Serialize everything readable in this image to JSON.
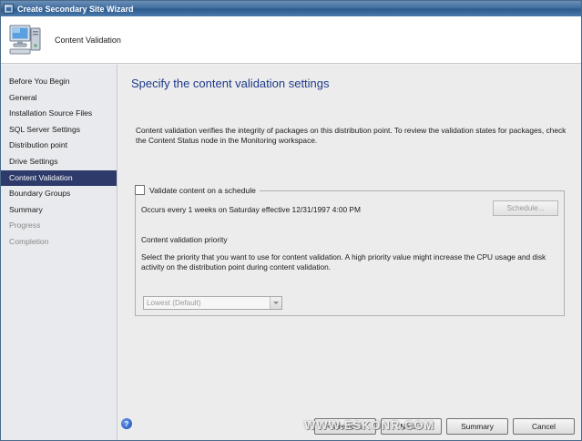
{
  "window": {
    "title": "Create Secondary Site Wizard"
  },
  "header": {
    "page_name": "Content Validation"
  },
  "sidebar": {
    "items": [
      {
        "label": "Before You Begin",
        "state": "normal"
      },
      {
        "label": "General",
        "state": "normal"
      },
      {
        "label": "Installation Source Files",
        "state": "normal"
      },
      {
        "label": "SQL Server Settings",
        "state": "normal"
      },
      {
        "label": "Distribution point",
        "state": "normal"
      },
      {
        "label": "Drive Settings",
        "state": "normal"
      },
      {
        "label": "Content Validation",
        "state": "active"
      },
      {
        "label": "Boundary Groups",
        "state": "normal"
      },
      {
        "label": "Summary",
        "state": "normal"
      },
      {
        "label": "Progress",
        "state": "disabled"
      },
      {
        "label": "Completion",
        "state": "disabled"
      }
    ]
  },
  "main": {
    "title": "Specify the content validation settings",
    "description": "Content validation verifies the integrity of packages on this distribution point. To review the validation states for packages, check the Content Status node in the Monitoring workspace.",
    "validate_checkbox": {
      "label": "Validate content on a schedule",
      "checked": false
    },
    "schedule_text": "Occurs every 1 weeks on Saturday effective 12/31/1997 4:00 PM",
    "schedule_button": "Schedule...",
    "priority_heading": "Content validation priority",
    "priority_description": "Select the priority that you want to use for content validation. A high priority value might increase the CPU usage and disk activity on the distribution point during content validation.",
    "priority_select": {
      "value": "Lowest (Default)"
    }
  },
  "footer": {
    "help_glyph": "?",
    "prev_label": "< Previous",
    "next_label": "Next >",
    "summary_label": "Summary",
    "cancel_label": "Cancel"
  },
  "watermark": "WWW.ESKONR.COM",
  "colors": {
    "accent_title": "#1e3a8a",
    "active_nav": "#2d3a6a",
    "titlebar": "#3e6a9c"
  }
}
